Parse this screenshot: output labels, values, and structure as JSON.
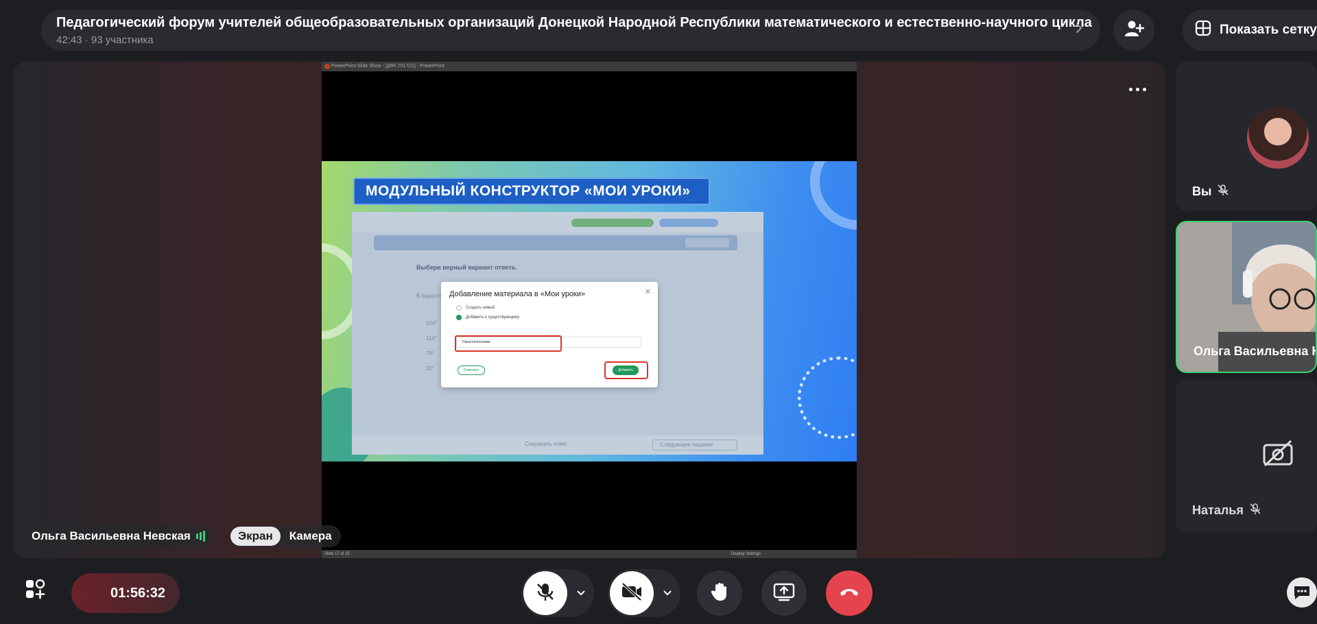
{
  "header": {
    "title": "Педагогический форум учителей общеобразовательных организаций Донецкой Народной Республики математического и естественно-научного цикла",
    "subtitle": "42:43 · 93 участника",
    "grid_button_label": "Показать сетку"
  },
  "stage": {
    "speaker_name": "Ольга Васильевна Невская",
    "view_options": [
      "Экран",
      "Камера"
    ],
    "active_view": "Экран"
  },
  "shared_screen": {
    "window_title": "PowerPoint Slide Show - [ДФК 2017(2)] - PowerPoint",
    "status_left": "Slide 17 of 25",
    "status_right": "Display Settings",
    "slide": {
      "title": "МОДУЛЬНЫЙ КОНСТРУКТОР «МОИ УРОКИ»",
      "question": "Выбери верный вариант ответа.",
      "question_text": "В параллело...",
      "answers": [
        "104°",
        "114°",
        "76°",
        "32°"
      ],
      "bottom_left": "Сохранить ответ",
      "bottom_right": "Следующее задание",
      "dialog": {
        "title": "Добавление материала в «Мои уроки»",
        "option_new": "Создать новый",
        "option_existing": "Добавить к существующему",
        "field_value": "Параллелограмм",
        "cancel_label": "Отменить",
        "add_label": "Добавить"
      }
    }
  },
  "participants": [
    {
      "name": "Вы",
      "mic": "off"
    },
    {
      "name": "Ольга Васильевна Не",
      "speaking": true
    },
    {
      "name": "Наталья",
      "mic": "off",
      "camera": "off"
    }
  ],
  "controls": {
    "timer": "01:56:32"
  },
  "colors": {
    "background": "#1d1e22",
    "panel": "#2a2b30",
    "speaking_green": "#3bd16f",
    "end_call_red": "#e5444f",
    "slide_title_blue": "#1d5fc4",
    "highlight_red": "#d9332a"
  },
  "icons": {
    "chevron": "chevron-right-icon",
    "add_user": "add-user-icon",
    "grid": "grid-icon",
    "more": "more-horizontal-icon",
    "mic_off": "mic-off-icon",
    "camera_off": "camera-off-icon",
    "hand": "raise-hand-icon",
    "share": "screen-share-icon",
    "end_call": "end-call-icon",
    "apps": "apps-icon",
    "chat": "chat-icon"
  }
}
